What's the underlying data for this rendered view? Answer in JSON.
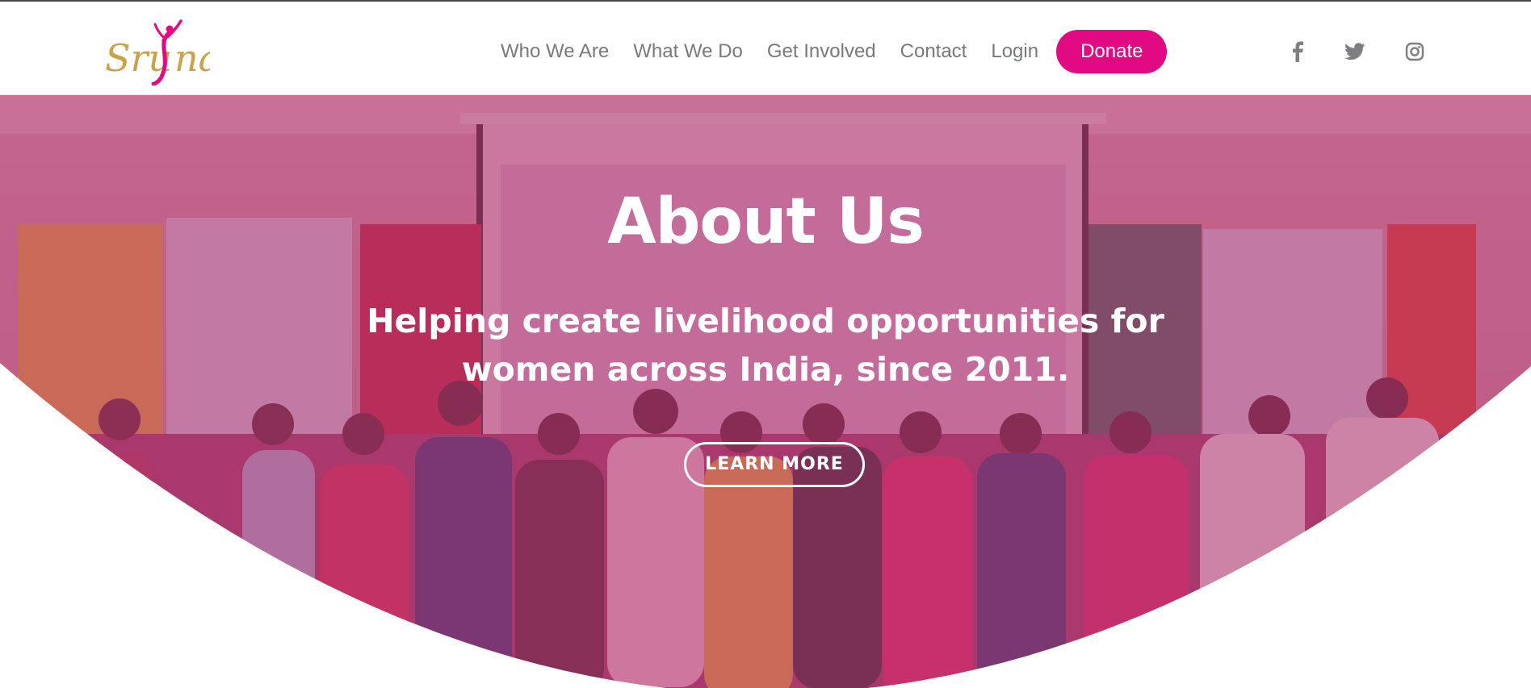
{
  "brand": {
    "logo_text": "Srujna",
    "primary_color": "#e10a83",
    "logo_gold": "#c9a24c"
  },
  "nav": {
    "items": [
      {
        "label": "Who We Are"
      },
      {
        "label": "What We Do"
      },
      {
        "label": "Get Involved"
      },
      {
        "label": "Contact"
      },
      {
        "label": "Login"
      }
    ],
    "donate_label": "Donate"
  },
  "social": [
    {
      "icon": "facebook-icon"
    },
    {
      "icon": "twitter-icon"
    },
    {
      "icon": "instagram-icon"
    }
  ],
  "hero": {
    "title": "About Us",
    "subtitle_line1": "Helping create livelihood opportunities for",
    "subtitle_line2": "women across India, since 2011.",
    "cta_label": "LEARN MORE",
    "overlay_color": "#b4336e"
  }
}
